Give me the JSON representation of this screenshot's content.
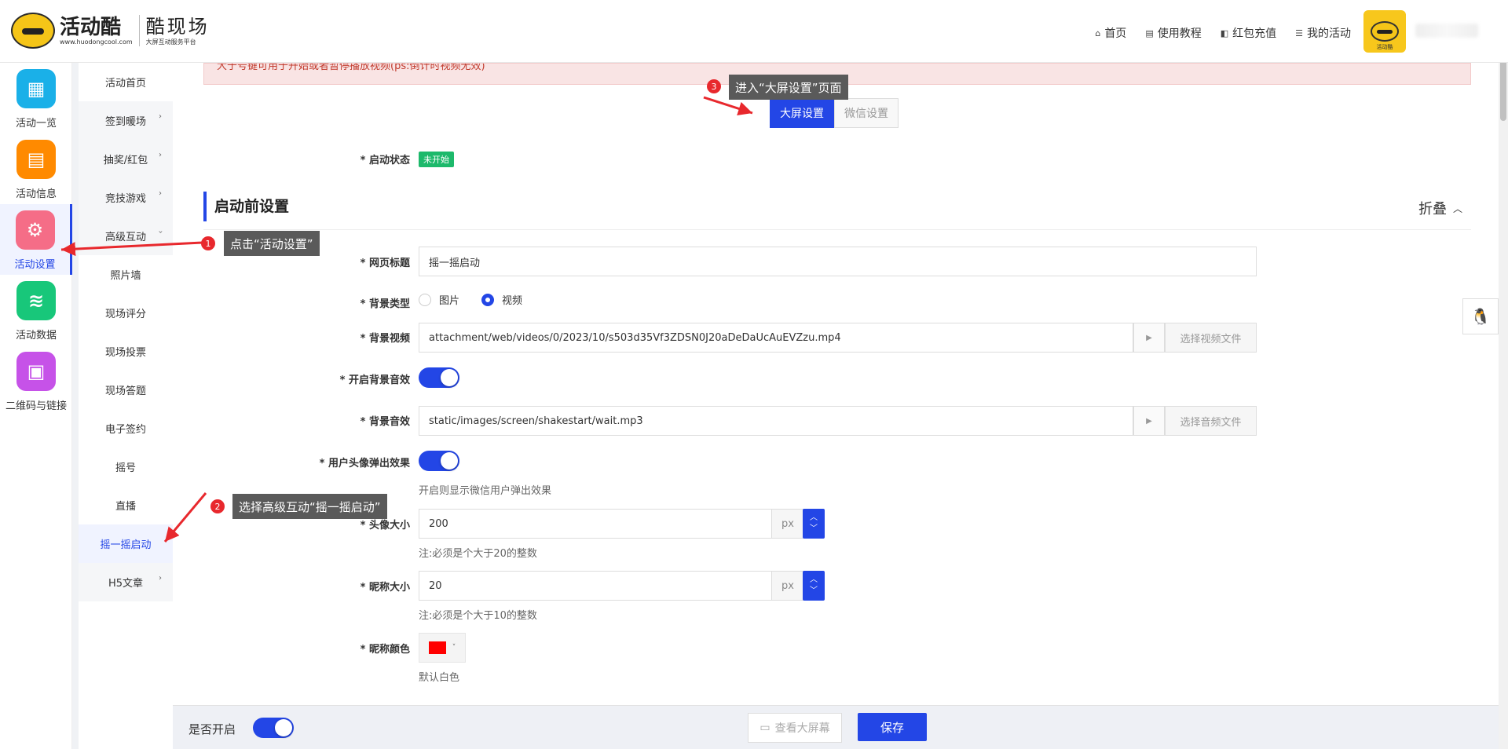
{
  "header": {
    "brand_name": "活动酷",
    "brand_url": "www.huodongcool.com",
    "sub_brand": "酷现场",
    "sub_brand_tag": "大屏互动服务平台",
    "nav": [
      {
        "label": "首页",
        "icon": "home-icon"
      },
      {
        "label": "使用教程",
        "icon": "document-icon"
      },
      {
        "label": "红包充值",
        "icon": "wallet-icon"
      },
      {
        "label": "我的活动",
        "icon": "list-icon"
      }
    ],
    "avatar_label": "活动酷"
  },
  "rail": [
    {
      "label": "活动一览",
      "icon": "grid-icon",
      "color": "#1ab0e8"
    },
    {
      "label": "活动信息",
      "icon": "file-icon",
      "color": "#ff8a00"
    },
    {
      "label": "活动设置",
      "icon": "gear-icon",
      "color": "#f56d87",
      "active": true
    },
    {
      "label": "活动数据",
      "icon": "database-icon",
      "color": "#18c77a"
    },
    {
      "label": "二维码与链接",
      "icon": "qrcode-icon",
      "color": "#c652e8"
    }
  ],
  "submenu": [
    {
      "label": "活动首页"
    },
    {
      "label": "签到暖场",
      "arrow": "›"
    },
    {
      "label": "抽奖/红包",
      "arrow": "›"
    },
    {
      "label": "竞技游戏",
      "arrow": "›"
    },
    {
      "label": "高级互动",
      "arrow": "›"
    },
    {
      "label": "照片墙"
    },
    {
      "label": "现场评分"
    },
    {
      "label": "现场投票"
    },
    {
      "label": "现场答题"
    },
    {
      "label": "电子签约"
    },
    {
      "label": "摇号"
    },
    {
      "label": "直播"
    },
    {
      "label": "摇一摇启动",
      "active": true
    },
    {
      "label": "H5文章",
      "arrow": "›"
    }
  ],
  "notice": "大于号键可用于开始或者暂停播放视频(ps:倒计时视频无效)",
  "tabs": {
    "big_screen": "大屏设置",
    "wechat": "微信设置"
  },
  "status": {
    "label": "* 启动状态",
    "value": "未开始"
  },
  "section": {
    "title": "启动前设置",
    "fold": "折叠",
    "fold_icon": "chevron-up-icon"
  },
  "form": {
    "page_title_label": "* 网页标题",
    "page_title_value": "摇一摇启动",
    "bg_type_label": "* 背景类型",
    "bg_type_options": [
      "图片",
      "视频"
    ],
    "bg_type_selected": "视频",
    "bg_video_label": "* 背景视频",
    "bg_video_value": "attachment/web/videos/0/2023/10/s503d35Vf3ZDSN0J20aDeDaUcAuEVZzu.mp4",
    "bg_video_button": "选择视频文件",
    "bg_audio_toggle_label": "* 开启背景音效",
    "bg_audio_toggle_on": true,
    "bg_audio_label": "* 背景音效",
    "bg_audio_value": "static/images/screen/shakestart/wait.mp3",
    "bg_audio_button": "选择音频文件",
    "avatar_popup_label": "* 用户头像弹出效果",
    "avatar_popup_on": true,
    "avatar_popup_hint": "开启则显示微信用户弹出效果",
    "avatar_size_label": "* 头像大小",
    "avatar_size_value": "200",
    "avatar_size_unit": "px",
    "avatar_size_hint": "注:必须是个大于20的整数",
    "nick_size_label": "* 昵称大小",
    "nick_size_value": "20",
    "nick_size_unit": "px",
    "nick_size_hint": "注:必须是个大于10的整数",
    "nick_color_label": "* 昵称颜色",
    "nick_color_value": "#ff0000",
    "nick_color_hint": "默认白色"
  },
  "bottom": {
    "enable_label": "是否开启",
    "enable_on": true,
    "preview_label": "查看大屏幕",
    "save_label": "保存"
  },
  "annotations": [
    {
      "num": "1",
      "text": "点击“活动设置”"
    },
    {
      "num": "2",
      "text": "选择高级互动“摇一摇启动”"
    },
    {
      "num": "3",
      "text": "进入“大屏设置”页面"
    }
  ]
}
